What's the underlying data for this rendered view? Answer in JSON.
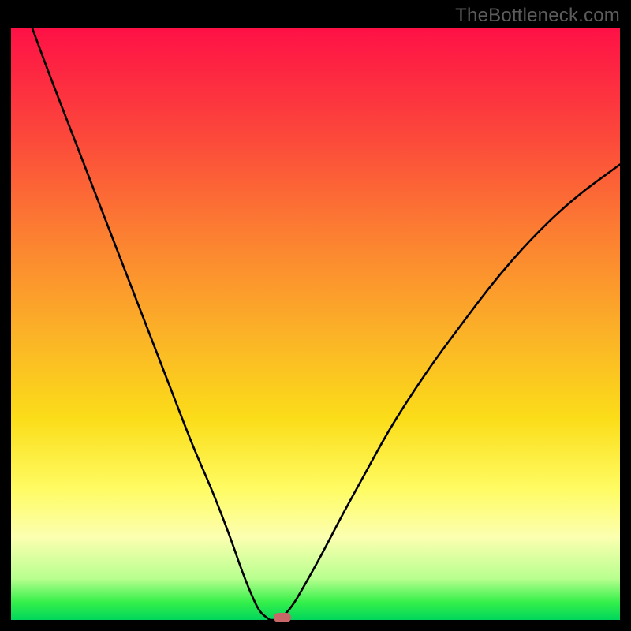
{
  "watermark": {
    "text": "TheBottleneck.com"
  },
  "chart_data": {
    "type": "line",
    "title": "",
    "xlabel": "",
    "ylabel": "",
    "x": [
      0.0,
      0.02,
      0.04,
      0.06,
      0.08,
      0.1,
      0.12,
      0.14,
      0.16,
      0.18,
      0.2,
      0.22,
      0.24,
      0.26,
      0.28,
      0.3,
      0.32,
      0.34,
      0.36,
      0.38,
      0.4,
      0.42,
      0.44,
      0.46,
      0.48,
      0.5,
      0.52,
      0.54,
      0.56,
      0.58,
      0.6,
      0.62,
      0.64,
      0.66,
      0.68,
      0.7,
      0.72,
      0.74,
      0.76,
      0.78,
      0.8,
      0.82,
      0.84,
      0.86,
      0.88,
      0.9,
      0.92,
      0.94,
      0.96,
      0.98,
      1.0
    ],
    "series": [
      {
        "name": "bottleneck-curve",
        "values_left_branch": {
          "x": [
            0.035,
            0.06,
            0.09,
            0.12,
            0.15,
            0.18,
            0.21,
            0.24,
            0.27,
            0.3,
            0.33,
            0.36,
            0.38,
            0.4,
            0.41,
            0.42,
            0.425
          ],
          "y": [
            1.0,
            0.93,
            0.85,
            0.77,
            0.69,
            0.61,
            0.53,
            0.45,
            0.37,
            0.29,
            0.22,
            0.14,
            0.08,
            0.03,
            0.012,
            0.004,
            0.0
          ]
        },
        "values_right_branch": {
          "x": [
            0.44,
            0.46,
            0.48,
            0.51,
            0.54,
            0.58,
            0.62,
            0.66,
            0.7,
            0.74,
            0.78,
            0.82,
            0.86,
            0.9,
            0.94,
            0.98,
            1.0
          ],
          "y": [
            0.0,
            0.02,
            0.055,
            0.11,
            0.17,
            0.245,
            0.32,
            0.385,
            0.445,
            0.5,
            0.555,
            0.605,
            0.65,
            0.69,
            0.725,
            0.755,
            0.77
          ]
        }
      }
    ],
    "marker": {
      "x": 0.445,
      "y": 0.0,
      "shape": "pill",
      "color": "#c86768"
    },
    "xlim": [
      0,
      1
    ],
    "ylim": [
      0,
      1
    ],
    "legend": false,
    "grid": false,
    "background": "gradient-red-to-green"
  },
  "colors": {
    "curve": "#000000",
    "marker": "#c86768",
    "frame": "#000000"
  }
}
